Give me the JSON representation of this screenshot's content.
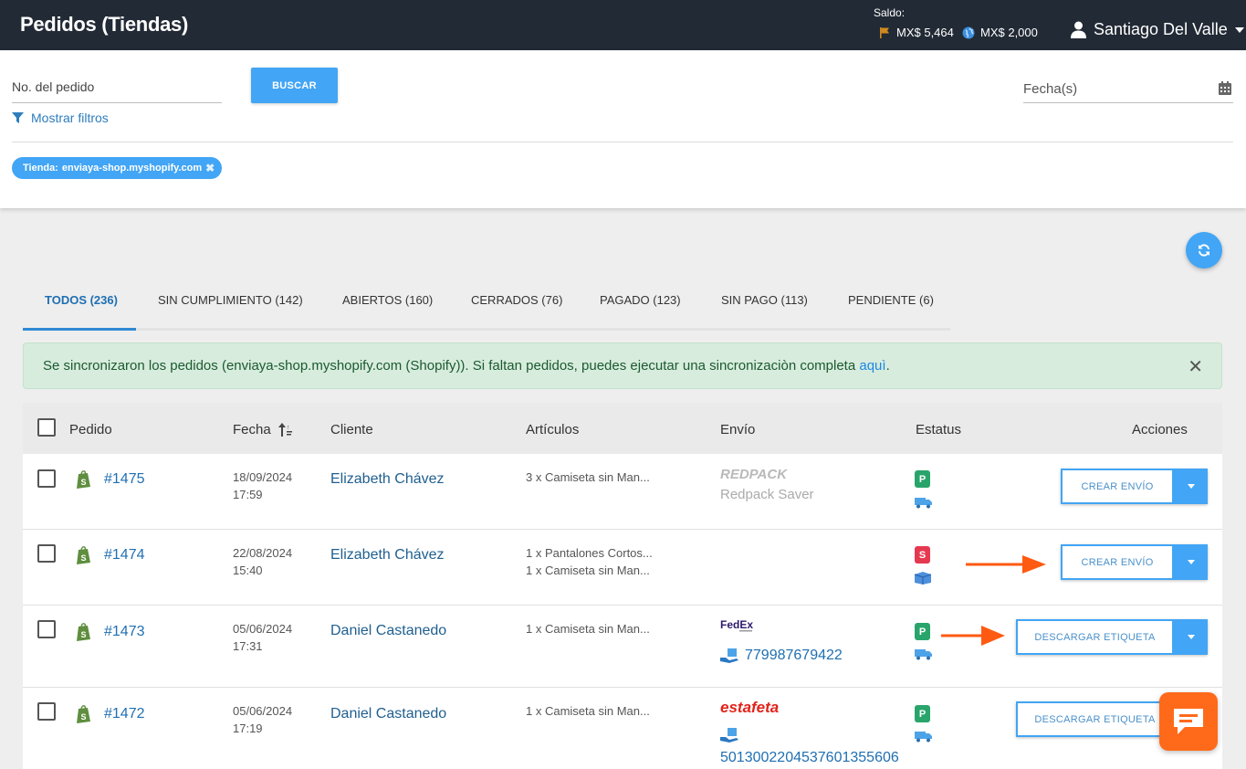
{
  "header": {
    "title": "Pedidos (Tiendas)",
    "saldo_label": "Saldo:",
    "balance_flag": "MX$ 5,464",
    "balance_globe": "MX$ 2,000",
    "user_name": "Santiago Del Valle"
  },
  "filters": {
    "order_placeholder": "No. del pedido",
    "search_button": "BUSCAR",
    "date_placeholder": "Fecha(s)",
    "show_filters": "Mostrar filtros",
    "chip_label": "Tienda:",
    "chip_value": "enviaya-shop.myshopify.com"
  },
  "tabs": [
    {
      "label": "TODOS (236)",
      "active": true
    },
    {
      "label": "SIN CUMPLIMIENTO (142)"
    },
    {
      "label": "ABIERTOS (160)"
    },
    {
      "label": "CERRADOS (76)"
    },
    {
      "label": "PAGADO (123)"
    },
    {
      "label": "SIN PAGO (113)"
    },
    {
      "label": "PENDIENTE (6)"
    }
  ],
  "alert": {
    "message": "Se sincronizaron los pedidos (enviaya-shop.myshopify.com (Shopify)). Si faltan pedidos, puedes ejecutar una sincronizaciòn completa ",
    "link": "aquì",
    "suffix": "."
  },
  "table": {
    "headers": {
      "order": "Pedido",
      "date": "Fecha",
      "client": "Cliente",
      "articles": "Artículos",
      "shipping": "Envío",
      "status": "Estatus",
      "actions": "Acciones"
    },
    "rows": [
      {
        "order": "#1475",
        "date": "18/09/2024",
        "time": "17:59",
        "client": "Elizabeth Chávez",
        "articles": [
          "3 x Camiseta sin Man..."
        ],
        "carrier_logo": "REDPACK",
        "carrier_service": "Redpack Saver",
        "status_badge": "P",
        "action": "CREAR ENVÍO"
      },
      {
        "order": "#1474",
        "date": "22/08/2024",
        "time": "15:40",
        "client": "Elizabeth Chávez",
        "articles": [
          "1 x Pantalones Cortos...",
          "1 x Camiseta sin Man..."
        ],
        "status_badge": "S",
        "action": "CREAR ENVÍO"
      },
      {
        "order": "#1473",
        "date": "05/06/2024",
        "time": "17:31",
        "client": "Daniel Castanedo",
        "articles": [
          "1 x Camiseta sin Man..."
        ],
        "carrier_logo": "FedEx",
        "tracking": "779987679422",
        "status_badge": "P",
        "action": "DESCARGAR ETIQUETA"
      },
      {
        "order": "#1472",
        "date": "05/06/2024",
        "time": "17:19",
        "client": "Daniel Castanedo",
        "articles": [
          "1 x Camiseta sin Man..."
        ],
        "carrier_logo": "estafeta",
        "tracking": "5013002204537601355606",
        "status_badge": "P",
        "action": "DESCARGAR ETIQUETA"
      }
    ]
  },
  "colors": {
    "topbar": "#222a35",
    "accent": "#42a5f5",
    "paid_badge": "#29a56b",
    "unpaid_badge": "#e53950",
    "arrow": "#ff5a12",
    "chat": "#ff6a1a"
  },
  "icons": [
    "flag-icon",
    "globe-icon",
    "user-icon",
    "caret-down-icon",
    "filter-icon",
    "calendar-icon",
    "refresh-icon",
    "sort-icon",
    "shopify-icon",
    "truck-icon",
    "box-icon",
    "package-icon",
    "chat-icon",
    "close-icon"
  ]
}
